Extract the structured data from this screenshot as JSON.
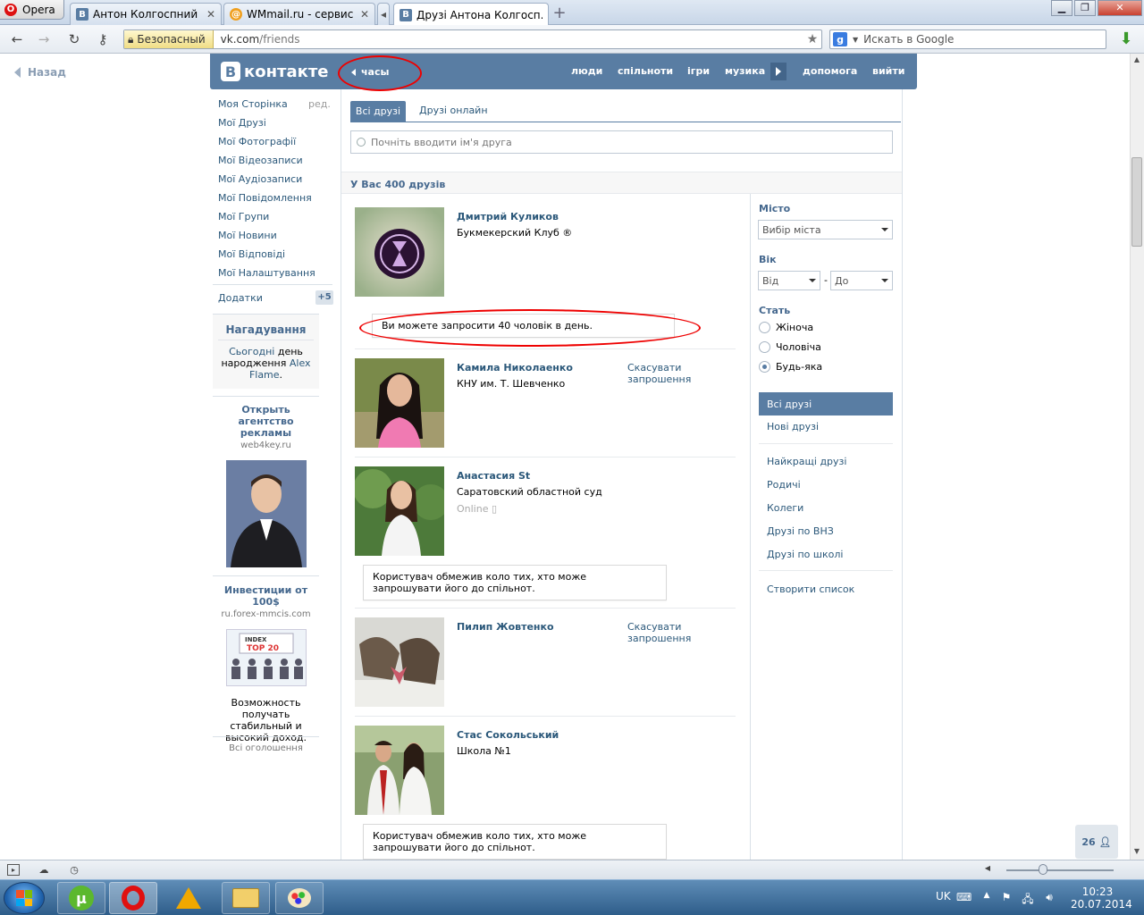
{
  "browser": {
    "opera_label": "Opera",
    "tabs": [
      {
        "title": "Антон Колгоспний",
        "icon": "vk-favicon"
      },
      {
        "title": "WMmail.ru - сервис п...",
        "icon": "wmmail-favicon"
      },
      {
        "title": "Друзі Антона Колгосп...",
        "icon": "vk-favicon",
        "active": true
      }
    ],
    "security_label": "Безопасный",
    "url_host": "vk.com",
    "url_path": "/friends",
    "search_placeholder": "Искать в Google"
  },
  "page": {
    "back_label": "Назад",
    "logo_text": "контакте",
    "logo_letter": "В",
    "clock_label": "часы",
    "nav": [
      "люди",
      "спільноти",
      "ігри",
      "музика",
      "допомога",
      "вийти"
    ],
    "left_menu": [
      "Моя Сторінка",
      "Мої Друзі",
      "Мої Фотографії",
      "Мої Відеозаписи",
      "Мої Аудіозаписи",
      "Мої Повідомлення",
      "Мої Групи",
      "Мої Новини",
      "Мої Відповіді",
      "Мої Налаштування"
    ],
    "edit_label": "ред.",
    "apps_label": "Додатки",
    "apps_badge": "+5",
    "reminder": {
      "title": "Нагадування",
      "today": "Сьогодні",
      "text_mid": " день народження ",
      "name": "Alex Flame",
      "dot": "."
    },
    "ads": [
      {
        "title": "Открыть агентство рекламы",
        "domain": "web4key.ru"
      },
      {
        "title": "Инвестиции от 100$",
        "domain": "ru.forex-mmcis.com",
        "text": "Возможность получать стабильный и высокий доход.",
        "img_text_1": "INDEX",
        "img_text_2": "TOP 20"
      }
    ],
    "all_ads_label": "Всі оголошення",
    "tabs": {
      "all": "Всі друзі",
      "online": "Друзі онлайн"
    },
    "search_placeholder": "Почніть вводити ім'я друга",
    "friends_count_label": "У Вас 400 друзів",
    "friends": [
      {
        "name": "Дмитрий Куликов",
        "info": "Букмекерский Клуб ®"
      },
      {
        "name": "Камила Николаенко",
        "info": "КНУ им. Т. Шевченко",
        "action": "Скасувати запрошення"
      },
      {
        "name": "Анастасия St",
        "info": "Саратовский областной суд",
        "status": "Online"
      },
      {
        "name": "Пилип Жовтенко",
        "action": "Скасувати запрошення"
      },
      {
        "name": "Стас Сокольський",
        "info": "Школа №1"
      }
    ],
    "notices": {
      "invite_limit": "Ви можете запросити 40 чоловік в день.",
      "restricted": "Користувач обмежив коло тих, хто може запрошувати його до спільнот."
    },
    "filters": {
      "city_label": "Місто",
      "city_select": "Вибір міста",
      "age_label": "Вік",
      "age_from": "Від",
      "age_dash": "-",
      "age_to": "До",
      "sex_label": "Стать",
      "sex_options": [
        "Жіноча",
        "Чоловіча",
        "Будь-яка"
      ],
      "sex_selected": "Будь-яка",
      "lists": [
        "Всі друзі",
        "Нові друзі",
        "Найкращі друзі",
        "Родичі",
        "Колеги",
        "Друзі по ВНЗ",
        "Друзі по школі",
        "Створити список"
      ]
    },
    "im_counter": "26"
  },
  "taskbar": {
    "lang": "UK",
    "time": "10:23",
    "date": "20.07.2014"
  },
  "colors": {
    "vk_blue": "#597da3",
    "link": "#2b587a",
    "highlight_red": "#e00000"
  }
}
